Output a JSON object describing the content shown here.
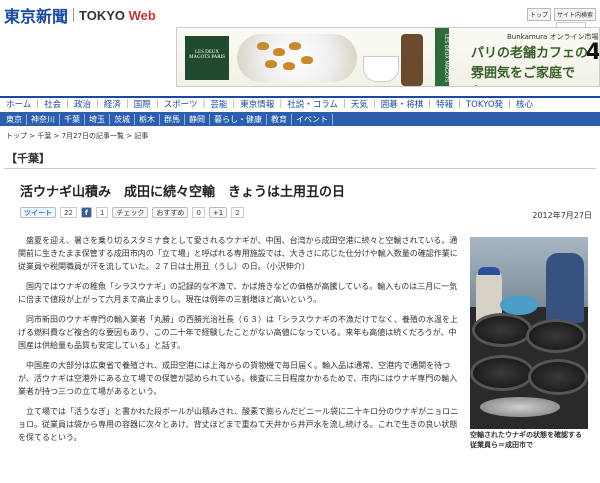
{
  "header": {
    "logo_jp": "東京新聞",
    "logo_en_prefix": "TOKYO ",
    "logo_en_web": "Web",
    "top_links": [
      "トップ",
      "サイト内検索"
    ]
  },
  "ad": {
    "brand": "LES DEUX MAGOTS PARIS",
    "tagline_top": "Bunkamura オンライン市場",
    "line1": "パリの老舗カフェの",
    "line2": "雰囲気をご家庭でも。",
    "side_text": "LES DEUX MAGOTS",
    "corner_num": "4"
  },
  "nav_primary": [
    "ホーム",
    "社会",
    "政治",
    "経済",
    "国際",
    "スポーツ",
    "芸能",
    "東京情報",
    "社説・コラム",
    "天気",
    "囲碁・将棋",
    "特報",
    "TOKYO発",
    "核心"
  ],
  "nav_secondary": [
    "東京",
    "神奈川",
    "千葉",
    "埼玉",
    "茨城",
    "栃木",
    "群馬",
    "静岡",
    "暮らし・健康",
    "教育",
    "イベント"
  ],
  "breadcrumb": "トップ > 千葉 > 7月27日の記事一覧 > 記事",
  "section_label": "【千葉】",
  "article": {
    "title": "活ウナギ山積み　成田に続々空輸　きょうは土用丑の日",
    "date": "2012年7月27日",
    "paragraphs": [
      "盛夏を迎え、暑さを乗り切るスタミナ食として愛されるウナギが、中国、台湾から成田空港に続々と空輸されている。通関前に生きたまま保管する成田市内の「立て場」と呼ばれる専用施設では、大きさに応じた仕分けや輸入数量の確認作業に従業員や税関職員が汗を流していた。２７日は土用丑（うし）の日。（小沢伸介）",
      "国内ではウナギの稚魚「シラスウナギ」の記録的な不漁で、かば焼きなどの価格が高騰している。輸入ものは三月に一気に倍まで値段が上がって六月まで高止まりし、現在は例年の三割増ほど高いという。",
      "同市新田のウナギ専門の輸入業者「丸勝」の西勝光治社長（６３）は「シラスウナギの不漁だけでなく、養殖の水温を上げる燃料費など複合的な要因もあり、この二十年で経験したことがない高値になっている。来年も高値は続くだろうが、中国産は供給量も品質も安定している」と話す。",
      "中国産の大部分は広東省で養殖され、成田空港には上海からの貨物機で毎日届く。輸入品は通常、空港内で通関を待つが、活ウナギは空港外にある立て場での保管が認められている。検査に三日程度かかるためで、市内にはウナギ専門の輸入業者が持つ三つの立て場があるという。",
      "立て場では「活うなぎ」と書かれた段ボールが山積みされ、酸素で膨らんだビニール袋に二十キロ分のウナギがニョロニョロ。従業員は袋から専用の容器に次々とあけ、背丈ほどまで重ねて天井から井戸水を流し続ける。これで生きの良い状態を保てるという。"
    ],
    "caption": "空輸されたウナギの状態を確認する従業員ら＝成田市で"
  },
  "social": {
    "tweet_label": "ツイート",
    "tweet_count": "22",
    "fb_label": "f",
    "fb_count": "1",
    "check_label": "チェック",
    "osusume_label": "おすすめ",
    "osusume_count": "0",
    "gplus_label": "+1",
    "gplus_count": "2"
  }
}
